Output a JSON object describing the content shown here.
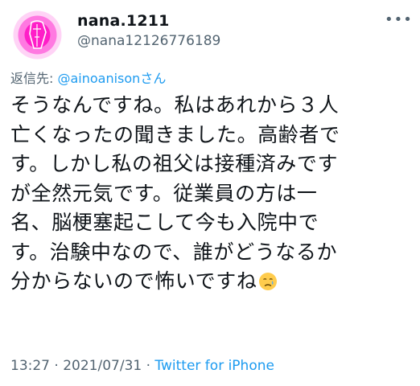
{
  "author": {
    "display_name": "nana.1211",
    "handle": "@nana12126776189"
  },
  "more_icon": "more-horizontal-icon",
  "reply": {
    "prefix": "返信先: ",
    "mention": "@ainoanisonさん"
  },
  "tweet": {
    "lines": [
      "そうなんですね。私はあれから３人",
      "亡くなったの聞きました。高齢者で",
      "す。しかし私の祖父は接種済みです",
      "が全然元気です。従業員の方は一",
      "名、脳梗塞起こして今も入院中で",
      "す。治験中なので、誰がどうなるか",
      "分からないので怖いですね"
    ],
    "emoji": "crying-face-icon"
  },
  "meta": {
    "time": "13:27",
    "separator": " · ",
    "date": "2021/07/31",
    "separator2": " · ",
    "source": "Twitter for iPhone"
  },
  "colors": {
    "text": "#0f1419",
    "secondary": "#536471",
    "link": "#1d9bf0",
    "avatar_neon": "#ff2fd0"
  }
}
